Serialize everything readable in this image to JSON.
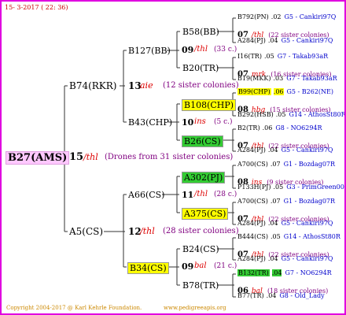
{
  "header": {
    "date": "15-  3-2017 ( 22: 36)"
  },
  "root": {
    "name": "B27(AMS)",
    "year": "15",
    "breeder": "/thl",
    "note": "(Drones from 31 sister colonies)"
  },
  "gen1": [
    {
      "name": "B74(RKR)",
      "year": "13",
      "breeder": "aie",
      "note": "(12 sister colonies)"
    },
    {
      "name": "A5(CS)",
      "year": "12",
      "breeder": "/thl",
      "note": "(28 sister colonies)"
    }
  ],
  "gen2": [
    {
      "name": "B127(BB)",
      "year": "09",
      "breeder": "/thl",
      "note": "(33 c.)"
    },
    {
      "name": "B43(CHP)",
      "year": "10",
      "breeder": "ins",
      "note": "(5 c.)"
    },
    {
      "name": "A66(CS)",
      "year": "11",
      "breeder": "/thl",
      "note": "(28 c.)"
    },
    {
      "name": "B34(CS)",
      "year": "09",
      "breeder": "bal",
      "note": "(21 c.)"
    }
  ],
  "gen3": [
    {
      "name": "B58(BB)"
    },
    {
      "name": "B20(TR)"
    },
    {
      "name": "B108(CHP)"
    },
    {
      "name": "B26(CS)"
    },
    {
      "name": "A302(PJ)"
    },
    {
      "name": "A375(CS)"
    },
    {
      "name": "B24(CS)"
    },
    {
      "name": "B78(TR)"
    }
  ],
  "gen4": [
    {
      "kind": "line",
      "name": "B792(PN)",
      "year": ".02",
      "origin": "G5 - Cankiri97Q"
    },
    {
      "kind": "mid",
      "year": "07",
      "breeder": "/thl",
      "note": "(22 sister colonies)"
    },
    {
      "kind": "line",
      "name": "A284(PJ)",
      "year": ".04",
      "origin": "G5 - Cankiri97Q"
    },
    {
      "kind": "line",
      "name": "I16(TR)",
      "year": ".05",
      "origin": "G7 - Takab93aR"
    },
    {
      "kind": "mid",
      "year": "07",
      "breeder": "mrk",
      "note": "(16 sister colonies)"
    },
    {
      "kind": "line",
      "name": "B19(MKK)",
      "year": ".03",
      "origin": "G7 - Takab93aR"
    },
    {
      "kind": "line",
      "name": "B99(CHP)",
      "year": ".06",
      "origin": "G5 - B262(NE)",
      "hl": "#ffff00"
    },
    {
      "kind": "mid",
      "year": "08",
      "breeder": "hbg",
      "note": "(15 sister colonies)"
    },
    {
      "kind": "line",
      "name": "B292(HSB)",
      "year": ".05",
      "origin": "G14 - AthosSt80R"
    },
    {
      "kind": "line",
      "name": "B2(TR)",
      "year": ".06",
      "origin": "G8 - NO6294R"
    },
    {
      "kind": "mid",
      "year": "07",
      "breeder": "/thl",
      "note": "(22 sister colonies)"
    },
    {
      "kind": "line",
      "name": "A284(PJ)",
      "year": ".04",
      "origin": "G5 - Cankiri97Q"
    },
    {
      "kind": "line",
      "name": "A700(CS)",
      "year": ".07",
      "origin": "G1 - Bozdag07R"
    },
    {
      "kind": "mid",
      "year": "08",
      "breeder": "ins",
      "note": "(9 sister colonies)"
    },
    {
      "kind": "line",
      "name": "P133H(PJ)",
      "year": ".05",
      "origin": "G3 - PrimGreen00"
    },
    {
      "kind": "line",
      "name": "A700(CS)",
      "year": ".07",
      "origin": "G1 - Bozdag07R"
    },
    {
      "kind": "mid",
      "year": "07",
      "breeder": "/thl",
      "note": "(22 sister colonies)"
    },
    {
      "kind": "line",
      "name": "A284(PJ)",
      "year": ".04",
      "origin": "G5 - Cankiri97Q"
    },
    {
      "kind": "line",
      "name": "B444(CS)",
      "year": ".05",
      "origin": "G14 - AthosSt80R"
    },
    {
      "kind": "mid",
      "year": "07",
      "breeder": "/thl",
      "note": "(22 sister colonies)"
    },
    {
      "kind": "line",
      "name": "A284(PJ)",
      "year": ".04",
      "origin": "G5 - Cankiri97Q"
    },
    {
      "kind": "line",
      "name": "B132(TR)",
      "year": ".04",
      "origin": "G7 - NO6294R",
      "hl": "#33cc33"
    },
    {
      "kind": "mid",
      "year": "06",
      "breeder": "bal",
      "note": "(18 sister colonies)"
    },
    {
      "kind": "line",
      "name": "B77(TR)",
      "year": ".04",
      "origin": "G8 - Old_Lady"
    }
  ],
  "footer": {
    "copyright": "Copyright 2004-2017 @ Karl Kehrle Foundation.",
    "site": "www.pedigreeapis.org"
  }
}
